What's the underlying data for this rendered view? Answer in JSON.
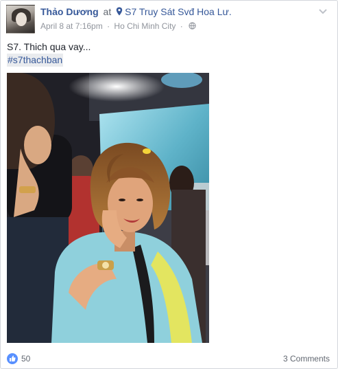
{
  "post": {
    "author": "Thảo Dương",
    "at_word": "at",
    "place": "S7 Truy Sát Svđ Hoa Lư.",
    "timestamp": "April 8 at 7:16pm",
    "location": "Ho Chi Minh City",
    "separator": "·",
    "message": "S7. Thich qua vay...",
    "hashtag": "#s7thachban"
  },
  "footer": {
    "like_count": "50",
    "comments": "3 Comments"
  },
  "colors": {
    "link": "#365899",
    "meta": "#90949c",
    "like_badge": "#5890ff",
    "border": "#d3d6db"
  },
  "icons": [
    "location-pin-icon",
    "globe-icon",
    "chevron-down-icon",
    "like-icon"
  ]
}
